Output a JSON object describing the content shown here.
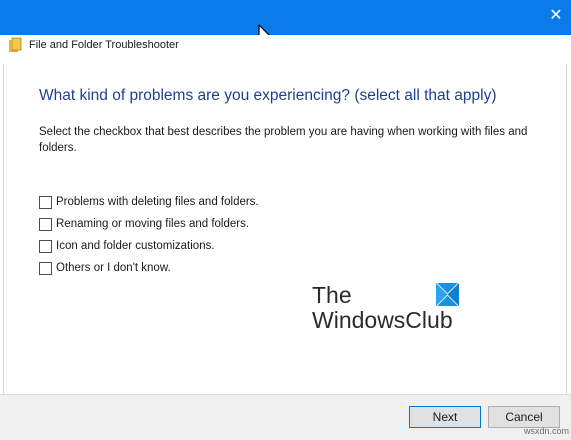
{
  "window": {
    "title": "File and Folder Troubleshooter",
    "close_glyph": "✕",
    "accent_color": "#0a7be8"
  },
  "content": {
    "heading": "What kind of problems are you experiencing? (select all that apply)",
    "instructions": "Select the checkbox that best describes the problem you are having when working with files and folders.",
    "options": [
      {
        "label": "Problems with deleting files and folders.",
        "checked": false
      },
      {
        "label": "Renaming or moving files and folders.",
        "checked": false
      },
      {
        "label": "Icon and folder customizations.",
        "checked": false
      },
      {
        "label": "Others or I don't know.",
        "checked": false
      }
    ]
  },
  "watermark": {
    "line1": "The",
    "line2": "WindowsClub",
    "logo_icon": "windows-logo-icon"
  },
  "footer": {
    "next_label": "Next",
    "cancel_label": "Cancel",
    "site_text": "wsxdn.com"
  }
}
